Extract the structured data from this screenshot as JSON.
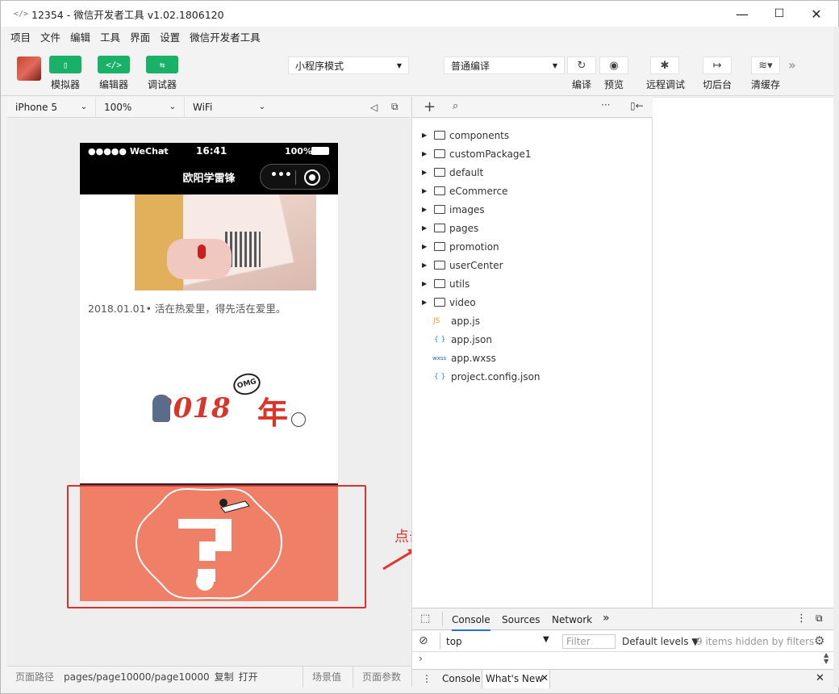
{
  "window": {
    "title": "12354 - 微信开发者工具 v1.02.1806120",
    "min": "—",
    "max": "☐",
    "close": "✕"
  },
  "menu": [
    "项目",
    "文件",
    "编辑",
    "工具",
    "界面",
    "设置",
    "微信开发者工具"
  ],
  "toolbar": {
    "simulator_label": "模拟器",
    "editor_label": "编辑器",
    "debugger_label": "调试器",
    "mode_select": "小程序模式",
    "compile_select": "普通编译",
    "compile_label": "编译",
    "preview_label": "预览",
    "remote_debug_label": "远程调试",
    "background_label": "切后台",
    "clear_cache_label": "清缓存",
    "more": "»"
  },
  "simulator": {
    "device": "iPhone 5",
    "zoom": "100%",
    "network": "WiFi"
  },
  "phone": {
    "carrier": "●●●●● WeChat",
    "time": "16:41",
    "battery": "100%",
    "nav_title": "欧阳学雷锋",
    "caption": "2018.01.01• 活在热爱里，得先活在爱里。",
    "year_text": "2018",
    "year_char": "年",
    "omg": "OMG"
  },
  "annotation": "点击一下",
  "files": {
    "folders": [
      "components",
      "customPackage1",
      "default",
      "eCommerce",
      "images",
      "pages",
      "promotion",
      "userCenter",
      "utils",
      "video"
    ],
    "files": [
      {
        "icon": "JS",
        "name": "app.js",
        "color": "#e3a21a"
      },
      {
        "icon": "{ }",
        "name": "app.json",
        "color": "#2b8fd6"
      },
      {
        "icon": "wxss",
        "name": "app.wxss",
        "color": "#2b5fb8"
      },
      {
        "icon": "{ }",
        "name": "project.config.json",
        "color": "#2b8fd6"
      }
    ]
  },
  "console": {
    "tabs": [
      "Console",
      "Sources",
      "Network"
    ],
    "more": "»",
    "context": "top",
    "filter_placeholder": "Filter",
    "levels": "Default levels ▼",
    "hidden": "9 items hidden by filters",
    "drawer_tabs": [
      "Console",
      "What's New"
    ]
  },
  "status": {
    "path_label": "页面路径",
    "path": "pages/page10000/page10000",
    "copy": "复制",
    "open": "打开",
    "scene": "场景值",
    "params": "页面参数"
  }
}
